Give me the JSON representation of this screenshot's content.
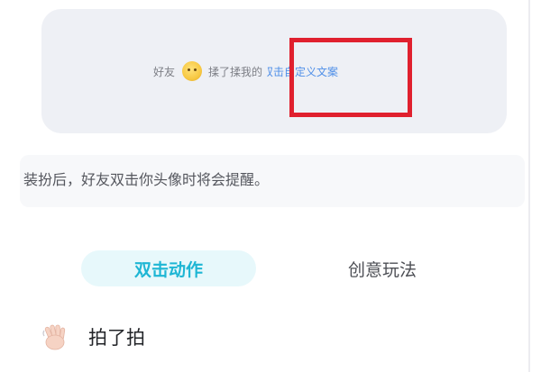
{
  "preview": {
    "friend_label": "好友",
    "action_text": "揉了揉我的",
    "partial_char": "双",
    "custom_text": "击自定义文案"
  },
  "hint": {
    "text": "装扮后，好友双击你头像时将会提醒。"
  },
  "tabs": [
    {
      "label": "双击动作",
      "active": true
    },
    {
      "label": "创意玩法",
      "active": false
    }
  ],
  "action_item": {
    "icon": "waving-hand-icon",
    "label": "拍了拍"
  },
  "colors": {
    "accent": "#1eb6d4",
    "link": "#4f8fe8",
    "highlight": "#e0202e"
  }
}
